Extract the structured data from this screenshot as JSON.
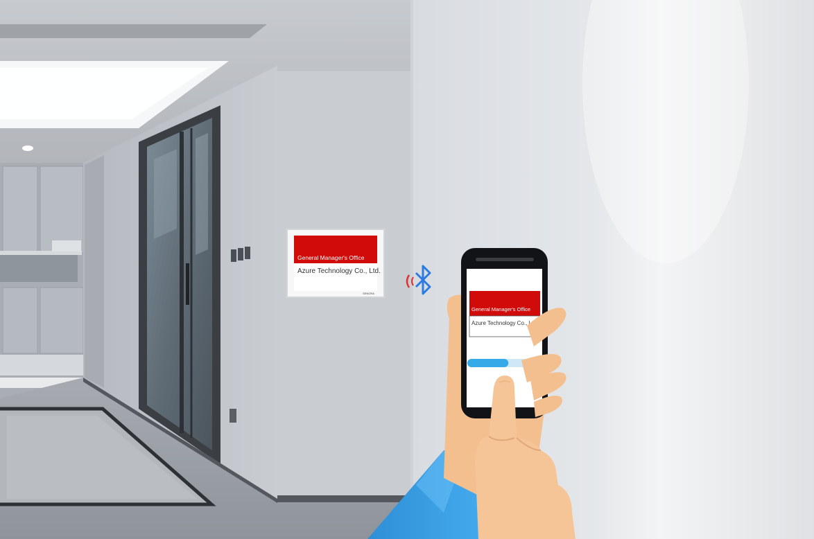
{
  "wall_sign": {
    "title": "General Manager's Office",
    "company": "Azure Technology Co., Ltd.",
    "brand_mark": "SENORA",
    "title_bg": "#d10a0a"
  },
  "phone_screen": {
    "title": "General Manager's Office",
    "company": "Azure Technology Co., Ltd.",
    "progress": 0.58,
    "progress_color": "#36a9e8"
  },
  "signal": {
    "icon": "bluetooth-icon",
    "color": "#2d7be0",
    "wave_color": "#e03030"
  }
}
